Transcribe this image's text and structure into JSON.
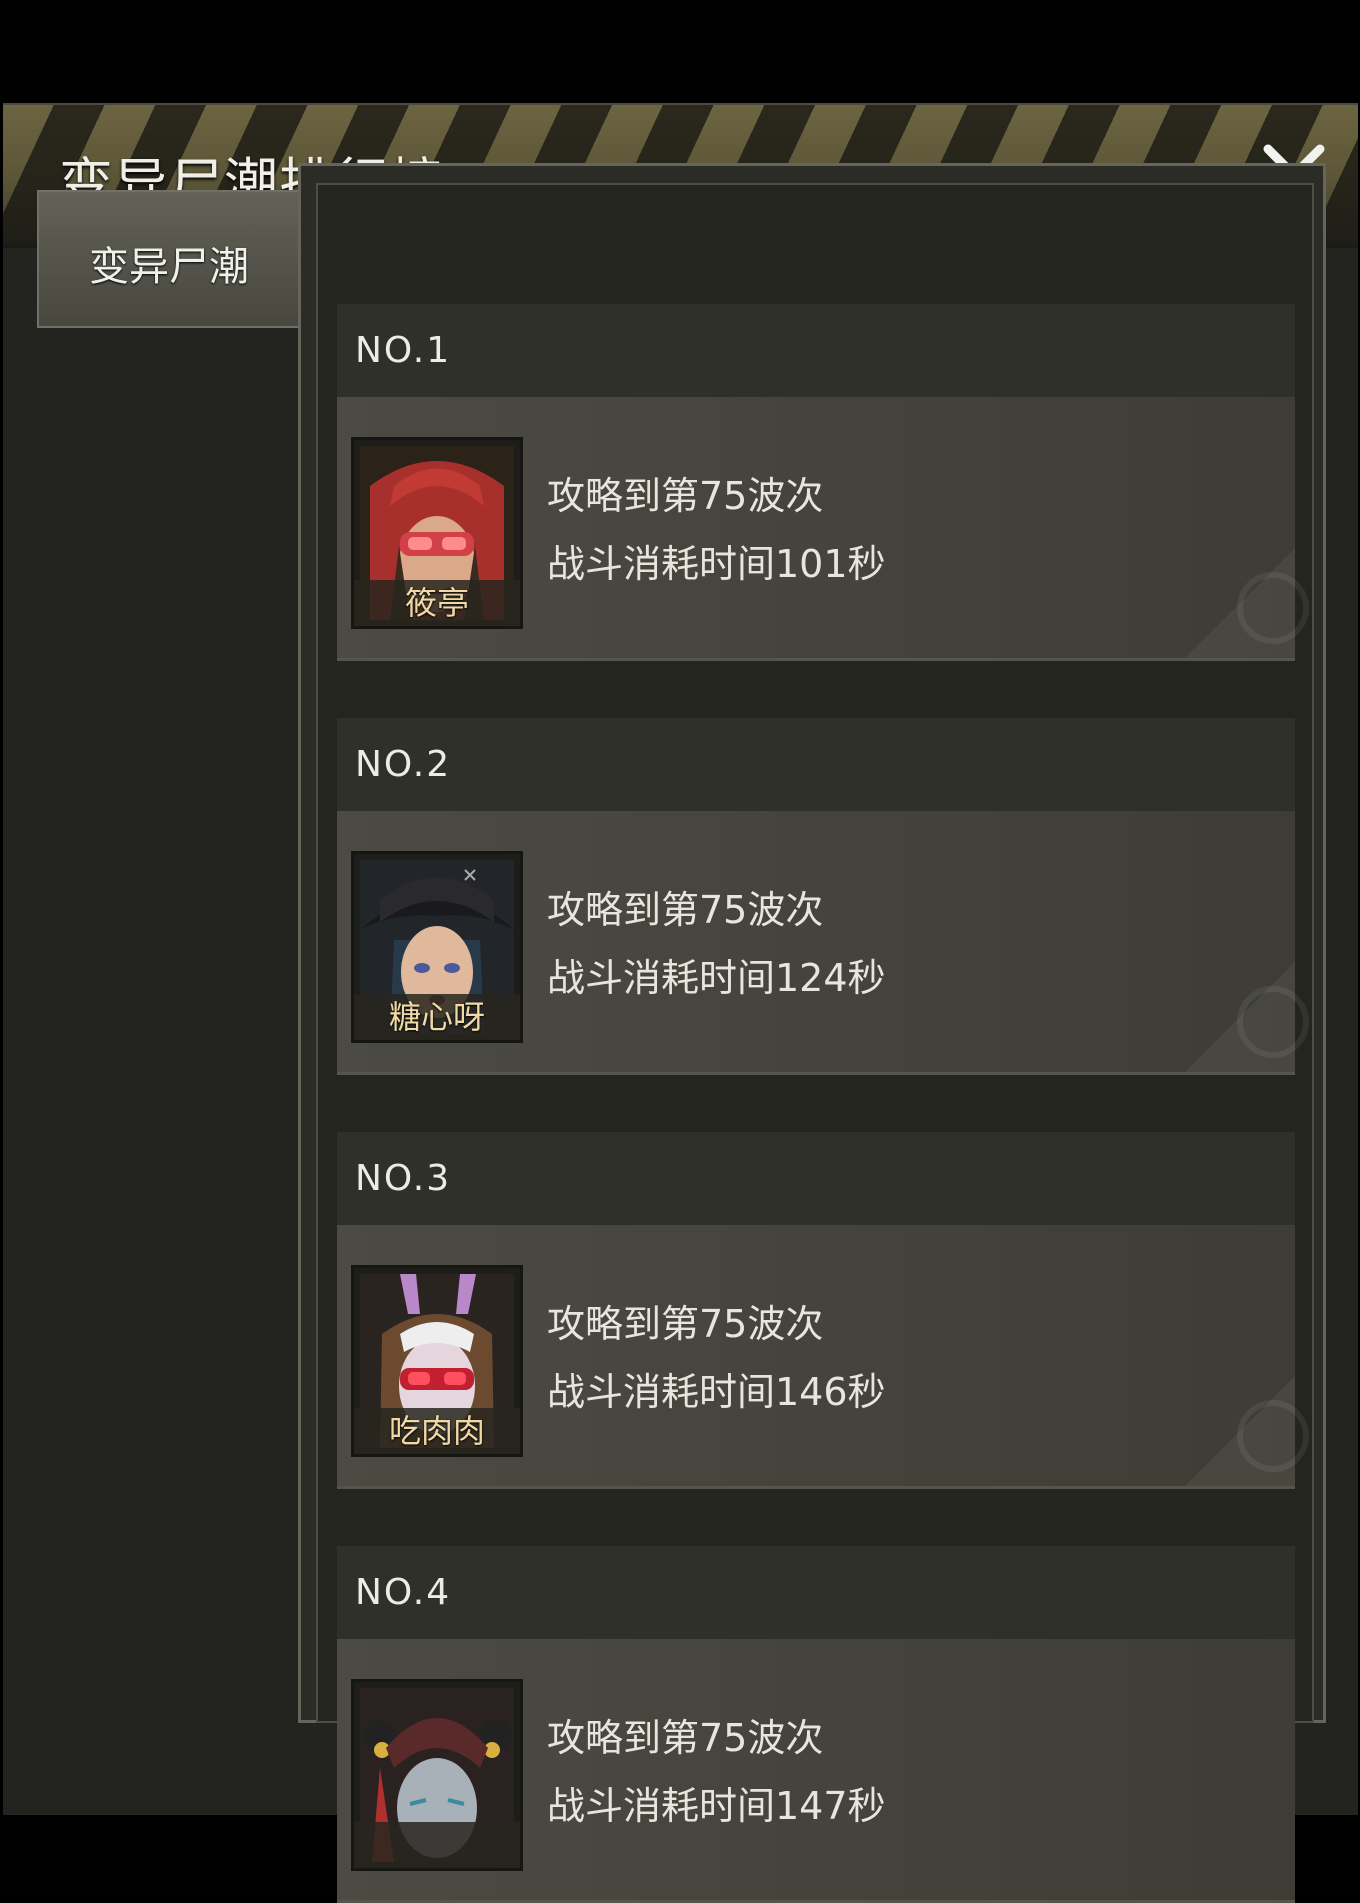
{
  "header": {
    "title": "变异尸潮排行榜"
  },
  "tabs": [
    {
      "label": "变异尸潮",
      "selected": true
    }
  ],
  "rankings": [
    {
      "rank": "NO.1",
      "name": "筱亭",
      "wave": "攻略到第75波次",
      "time": "战斗消耗时间101秒",
      "avatar_icon": "red-hood-goggles-portrait-icon"
    },
    {
      "rank": "NO.2",
      "name": "糖心呀",
      "wave": "攻略到第75波次",
      "time": "战斗消耗时间124秒",
      "avatar_icon": "pirate-hat-portrait-icon"
    },
    {
      "rank": "NO.3",
      "name": "吃肉肉",
      "wave": "攻略到第75波次",
      "time": "战斗消耗时间146秒",
      "avatar_icon": "bunny-ears-goggles-portrait-icon"
    },
    {
      "rank": "NO.4",
      "name": "",
      "wave": "攻略到第75波次",
      "time": "战斗消耗时间147秒",
      "avatar_icon": "topknot-warrior-portrait-icon"
    }
  ],
  "colors": {
    "panel": "#23241f",
    "header_stripe": "#6c6441",
    "name_text": "#f1d9a6"
  }
}
